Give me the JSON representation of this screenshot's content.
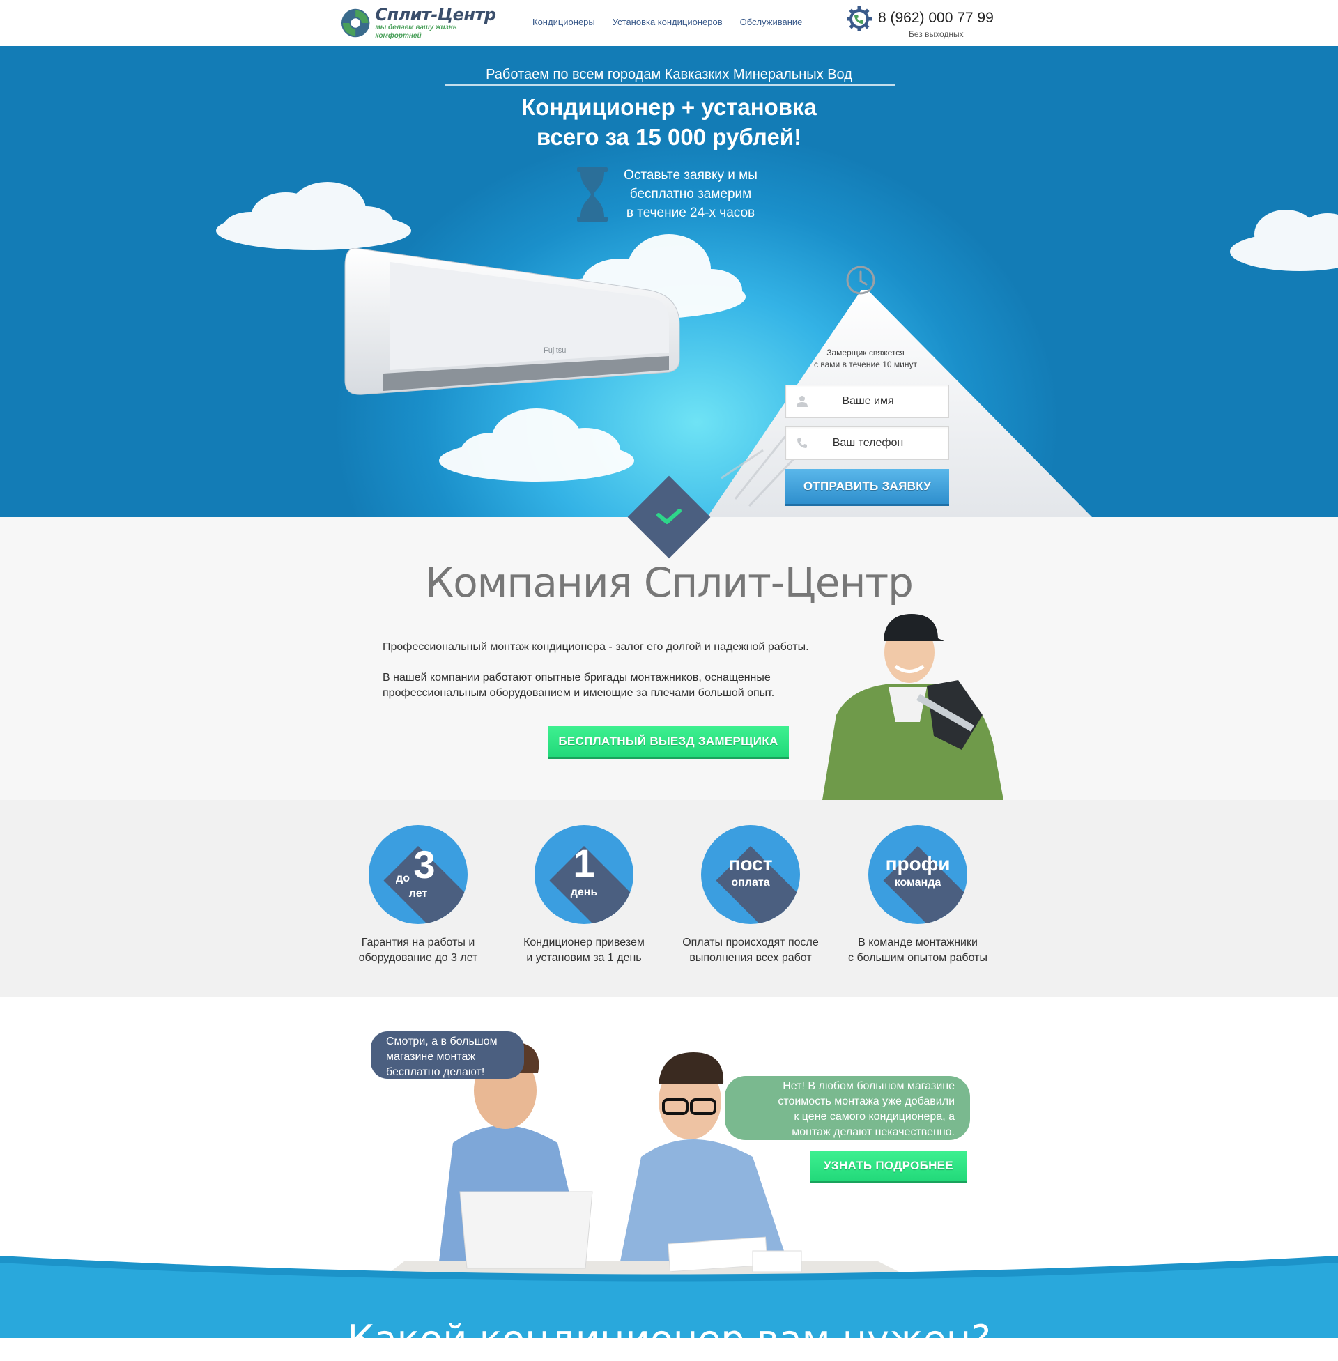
{
  "header": {
    "logo_title": "Сплит-Центр",
    "logo_slogan": "мы делаем вашу жизнь комфортней",
    "nav": [
      "Кондиционеры",
      "Установка кондиционеров",
      "Обслуживание"
    ],
    "phone": "8 (962) 000 77 99",
    "phone_note": "Без выходных"
  },
  "hero": {
    "city_line": "Работаем по всем городам Кавказких Минеральных Вод",
    "title_line1": "Кондиционер + установка",
    "title_line2": "всего за 15 000 рублей!",
    "sub_line1": "Оставьте заявку и мы",
    "sub_line2": "бесплатно замерим",
    "sub_line3": "в течение 24-х часов",
    "ac_brand": "Fujitsu"
  },
  "form": {
    "note_line1": "Замерщик свяжется",
    "note_line2": "с вами в течение 10 минут",
    "name_placeholder": "Ваше имя",
    "phone_placeholder": "Ваш телефон",
    "submit_label": "ОТПРАВИТЬ ЗАЯВКУ"
  },
  "company": {
    "title": "Компания Сплит-Центр",
    "para1": "Профессиональный монтаж кондиционера - залог его долгой и надежной работы.",
    "para2_line1": "В нашей компании работают опытные бригады монтажников, оснащенные",
    "para2_line2": "профессиональным оборудованием и имеющие за плечами большой опыт.",
    "cta_label": "БЕСПЛАТНЫЙ ВЫЕЗД ЗАМЕРЩИКА"
  },
  "features": [
    {
      "prefix": "до",
      "big": "3",
      "small": "лет",
      "line1": "Гарантия на работы и",
      "line2": "оборудование до 3 лет"
    },
    {
      "prefix": "",
      "big": "1",
      "small": "день",
      "line1": "Кондиционер привезем",
      "line2": "и установим за 1 день"
    },
    {
      "prefix": "",
      "big": "пост",
      "small": "оплата",
      "line1": "Оплаты происходят после",
      "line2": "выполнения всех работ"
    },
    {
      "prefix": "",
      "big": "профи",
      "small": "команда",
      "line1": "В команде монтажники",
      "line2": "с большим опытом работы"
    }
  ],
  "promo": {
    "left_l1": "Смотри, а в большом",
    "left_l2": "магазине монтаж",
    "left_l3": "бесплатно делают!",
    "right_l1": "Нет! В любом большом магазине",
    "right_l2": "стоимость монтажа уже добавили",
    "right_l3": "к цене самого кондиционера, а",
    "right_l4": "монтаж делают некачественно.",
    "cta_label": "УЗНАТЬ ПОДРОБНЕЕ",
    "bottom_title": "Какой кондиционер вам нужен?"
  },
  "colors": {
    "accent_blue": "#2f8fcd",
    "navy": "#4b5f80",
    "green_cta": "#22d97a",
    "bubble_green": "#7ab98f"
  }
}
